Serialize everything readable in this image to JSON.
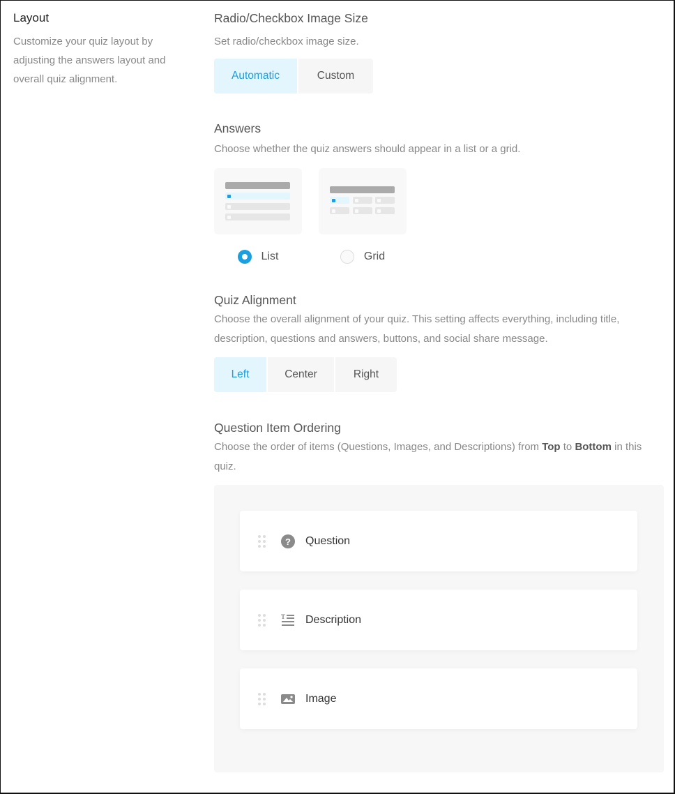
{
  "sidebar": {
    "title": "Layout",
    "description": "Customize your quiz layout by adjusting the answers layout and overall quiz alignment."
  },
  "image_size": {
    "title": "Radio/Checkbox Image Size",
    "description": "Set radio/checkbox image size.",
    "options": [
      {
        "label": "Automatic",
        "active": true
      },
      {
        "label": "Custom",
        "active": false
      }
    ]
  },
  "answers": {
    "title": "Answers",
    "description": "Choose whether the quiz answers should appear in a list or a grid.",
    "options": [
      {
        "label": "List",
        "selected": true
      },
      {
        "label": "Grid",
        "selected": false
      }
    ]
  },
  "alignment": {
    "title": "Quiz Alignment",
    "description": "Choose the overall alignment of your quiz. This setting affects everything, including title, description, questions and answers, buttons, and social share message.",
    "options": [
      {
        "label": "Left",
        "active": true
      },
      {
        "label": "Center",
        "active": false
      },
      {
        "label": "Right",
        "active": false
      }
    ]
  },
  "ordering": {
    "title": "Question Item Ordering",
    "description_pre": "Choose the order of items (Questions, Images, and Descriptions) from ",
    "bold_top": "Top",
    "description_mid": " to ",
    "bold_bottom": "Bottom",
    "description_post": " in this quiz.",
    "items": [
      {
        "label": "Question",
        "icon": "question-circle-icon"
      },
      {
        "label": "Description",
        "icon": "text-description-icon"
      },
      {
        "label": "Image",
        "icon": "image-icon"
      }
    ]
  },
  "colors": {
    "accent": "#1aa0e0",
    "active_bg": "#e3f5fd",
    "inactive_bg": "#f6f6f6"
  }
}
